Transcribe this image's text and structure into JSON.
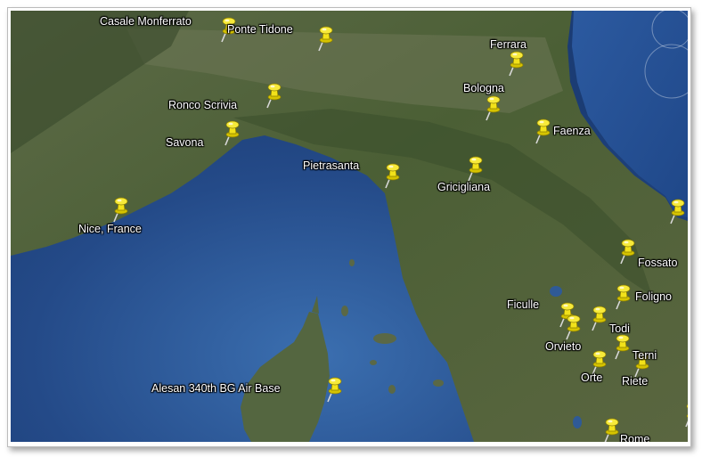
{
  "map": {
    "colors": {
      "sea_deep": "#1f3f7a",
      "sea_shallow": "#3a6aa3",
      "land_green": "#4a5f36",
      "land_dark": "#3a4b2c",
      "pin": "#f2e21a"
    },
    "labels": {
      "casale_monferrato": "Casale Monferrato",
      "ponte_tidone": "Ponte Tidone",
      "ferrara": "Ferrara",
      "bologna": "Bologna",
      "ronco_scrivia": "Ronco Scrivia",
      "savona": "Savona",
      "faenza": "Faenza",
      "pietrasanta": "Pietrasanta",
      "gricigliana": "Gricigliana",
      "nice_france": "Nice, France",
      "fossato": "Fossato",
      "foligno": "Foligno",
      "ficulle": "Ficulle",
      "todi": "Todi",
      "orvieto": "Orvieto",
      "terni": "Terni",
      "orte": "Orte",
      "riete": "Riete",
      "alesan": "Alesan  340th BG Air Base",
      "rome": "Rome"
    }
  }
}
